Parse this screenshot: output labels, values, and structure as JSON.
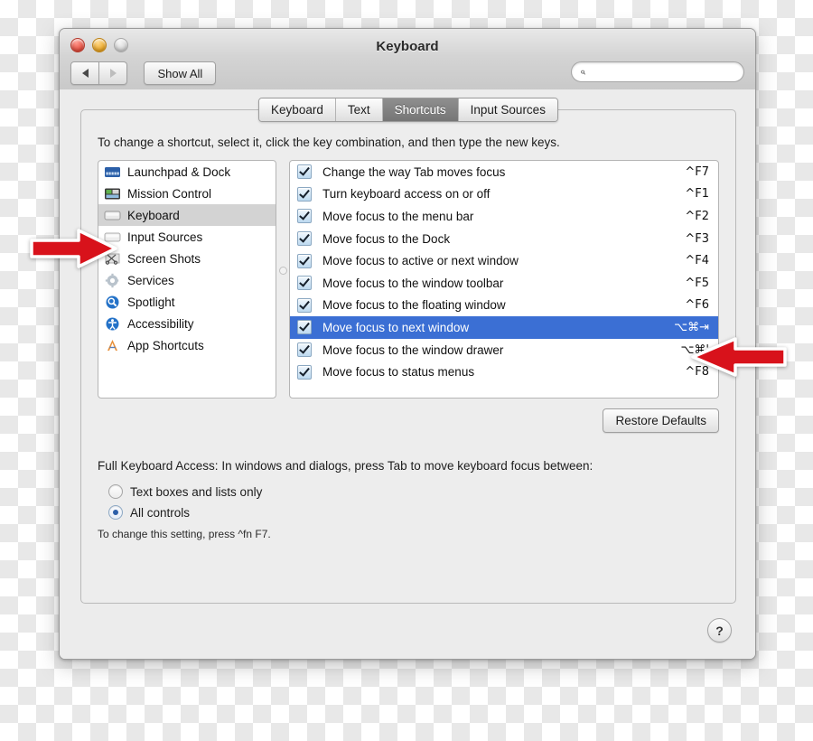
{
  "window": {
    "title": "Keyboard",
    "traffic_lights": [
      "close-red",
      "minimize-yellow",
      "zoom-disabled"
    ],
    "toolbar": {
      "back_label": "◀",
      "forward_label": "▶",
      "show_all_label": "Show All",
      "search_placeholder": "",
      "search_value": "",
      "search_icon": "search-icon"
    },
    "help_label": "?"
  },
  "tabs": [
    {
      "label": "Keyboard",
      "active": false
    },
    {
      "label": "Text",
      "active": false
    },
    {
      "label": "Shortcuts",
      "active": true
    },
    {
      "label": "Input Sources",
      "active": false
    }
  ],
  "hint": "To change a shortcut, select it, click the key combination, and then type the new keys.",
  "sidebar": {
    "items": [
      {
        "label": "Launchpad & Dock",
        "icon": "dock-icon",
        "selected": false
      },
      {
        "label": "Mission Control",
        "icon": "mission-control-icon",
        "selected": false
      },
      {
        "label": "Keyboard",
        "icon": "keyboard-icon",
        "selected": true
      },
      {
        "label": "Input Sources",
        "icon": "input-sources-icon",
        "selected": false
      },
      {
        "label": "Screen Shots",
        "icon": "screenshots-icon",
        "selected": false
      },
      {
        "label": "Services",
        "icon": "gear-icon",
        "selected": false
      },
      {
        "label": "Spotlight",
        "icon": "spotlight-icon",
        "selected": false
      },
      {
        "label": "Accessibility",
        "icon": "accessibility-icon",
        "selected": false
      },
      {
        "label": "App Shortcuts",
        "icon": "app-shortcuts-icon",
        "selected": false
      }
    ]
  },
  "shortcuts": {
    "rows": [
      {
        "checked": true,
        "name": "Change the way Tab moves focus",
        "key": "^F7",
        "selected": false
      },
      {
        "checked": true,
        "name": "Turn keyboard access on or off",
        "key": "^F1",
        "selected": false
      },
      {
        "checked": true,
        "name": "Move focus to the menu bar",
        "key": "^F2",
        "selected": false
      },
      {
        "checked": true,
        "name": "Move focus to the Dock",
        "key": "^F3",
        "selected": false
      },
      {
        "checked": true,
        "name": "Move focus to active or next window",
        "key": "^F4",
        "selected": false
      },
      {
        "checked": true,
        "name": "Move focus to the window toolbar",
        "key": "^F5",
        "selected": false
      },
      {
        "checked": true,
        "name": "Move focus to the floating window",
        "key": "^F6",
        "selected": false
      },
      {
        "checked": true,
        "name": "Move focus to next window",
        "key": "⌥⌘⇥",
        "selected": true
      },
      {
        "checked": true,
        "name": "Move focus to the window drawer",
        "key": "⌥⌘'",
        "selected": false
      },
      {
        "checked": true,
        "name": "Move focus to status menus",
        "key": "^F8",
        "selected": false
      }
    ]
  },
  "restore_defaults_label": "Restore Defaults",
  "full_keyboard_access": {
    "label": "Full Keyboard Access: In windows and dialogs, press Tab to move keyboard focus between:",
    "options": [
      {
        "label": "Text boxes and lists only",
        "selected": false
      },
      {
        "label": "All controls",
        "selected": true
      }
    ],
    "note": "To change this setting, press ^fn F7."
  },
  "annotations": {
    "arrow_color": "#d8121b",
    "left_arrow_target": "sidebar-item-keyboard",
    "right_arrow_target": "shortcut-row-selected"
  },
  "colors": {
    "selection_blue": "#3b6fd4",
    "sidebar_selection_gray": "#d3d3d3",
    "tab_active_gray": "#767676",
    "window_bg": "#ececec"
  }
}
